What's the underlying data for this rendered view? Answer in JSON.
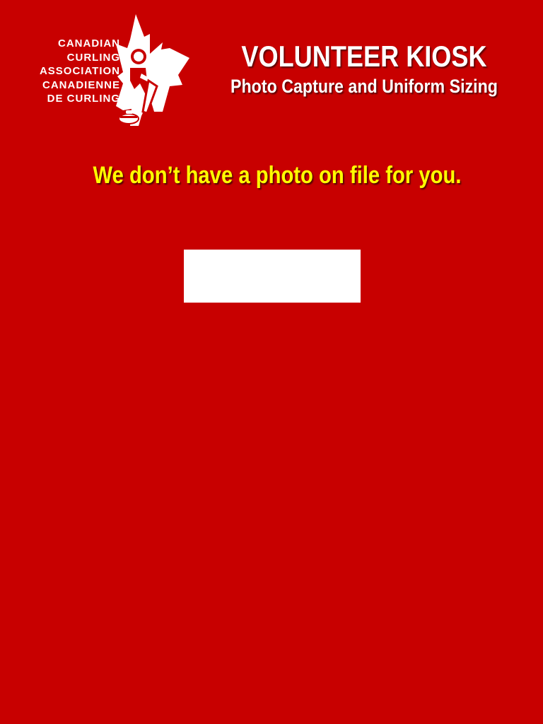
{
  "logo": {
    "lines": [
      "CANADIAN",
      "CURLING",
      "ASSOCIATION",
      "CANADIENNE",
      "DE CURLING"
    ],
    "icon": "maple-leaf-curler-icon"
  },
  "header": {
    "title": "VOLUNTEER KIOSK",
    "subtitle": "Photo Capture and Uniform Sizing"
  },
  "main": {
    "message": "We don’t have a photo on file for you.",
    "action_label": ""
  },
  "colors": {
    "background": "#c80000",
    "title_text": "#ffffff",
    "message_text": "#ffff00",
    "box": "#ffffff"
  }
}
